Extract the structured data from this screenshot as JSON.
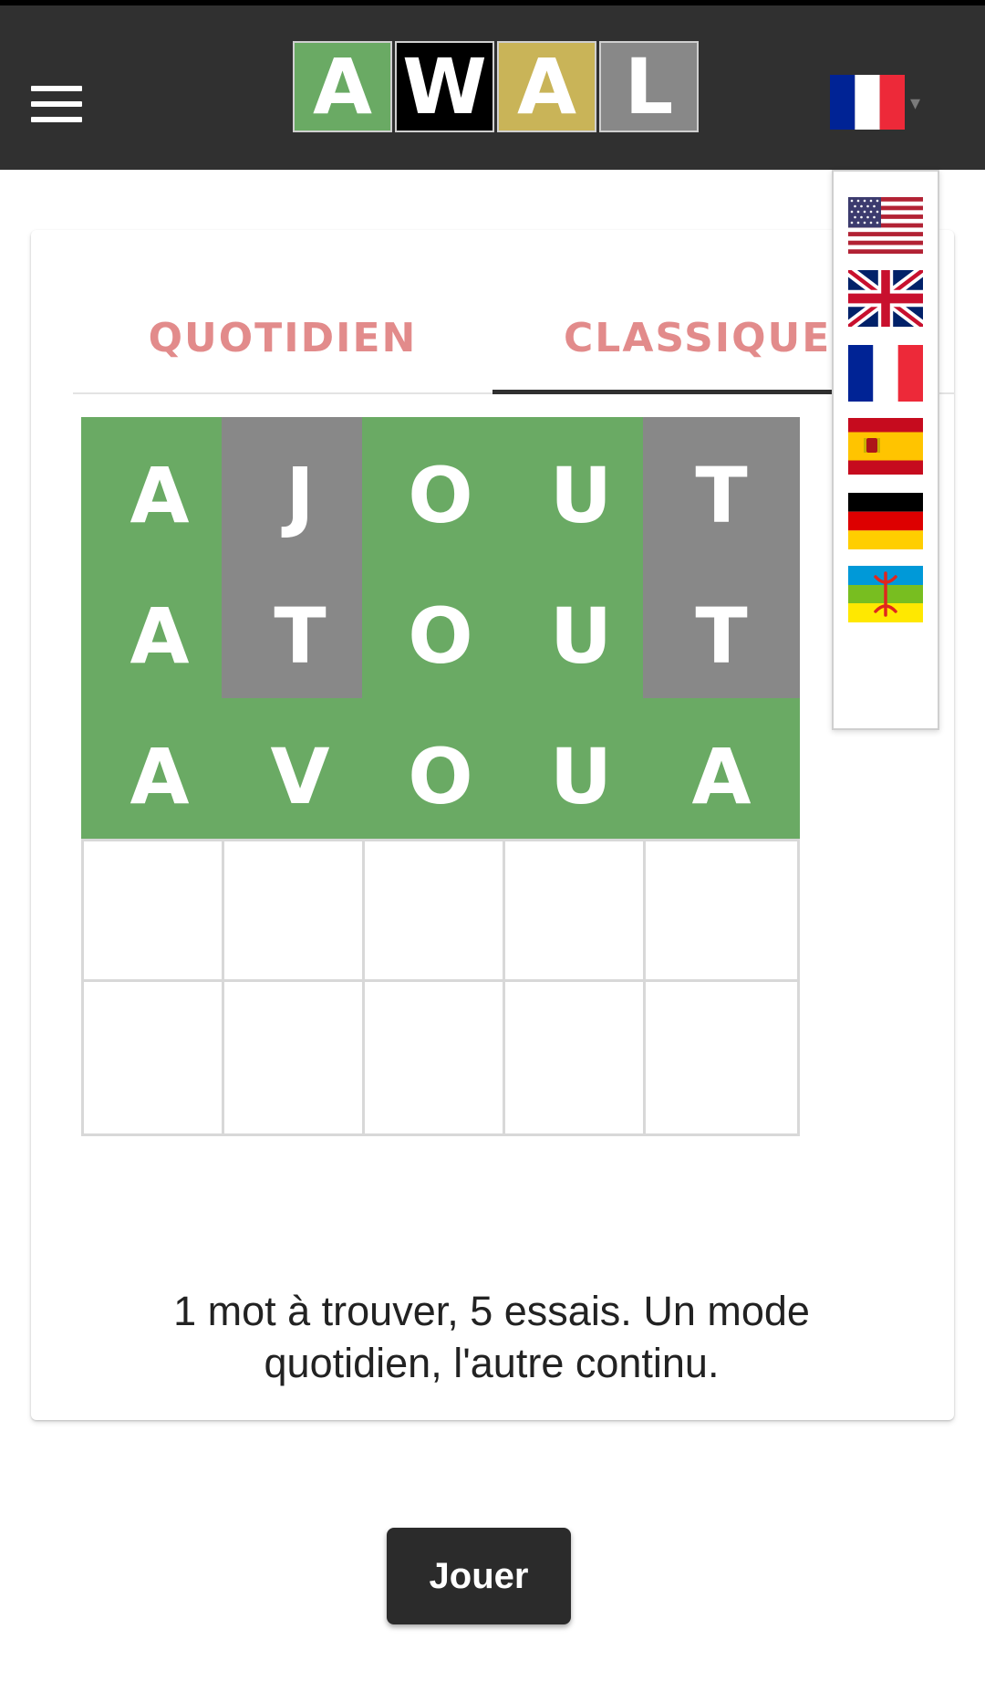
{
  "header": {
    "menu_icon": "hamburger-menu-icon",
    "logo_letters": [
      {
        "char": "A",
        "color": "#6aaa64"
      },
      {
        "char": "W",
        "color": "#000000"
      },
      {
        "char": "A",
        "color": "#c9b458"
      },
      {
        "char": "L",
        "color": "#888888"
      }
    ],
    "current_language": "fr",
    "dropdown_caret": "▾"
  },
  "tabs": {
    "daily_label": "QUOTIDIEN",
    "classic_label": "CLASSIQUE",
    "active": "classic"
  },
  "board": {
    "colors": {
      "green": "#6aaa64",
      "gray": "#888888"
    },
    "rows": [
      [
        {
          "l": "A",
          "s": "green"
        },
        {
          "l": "J",
          "s": "gray"
        },
        {
          "l": "O",
          "s": "green"
        },
        {
          "l": "U",
          "s": "green"
        },
        {
          "l": "T",
          "s": "gray"
        }
      ],
      [
        {
          "l": "A",
          "s": "green"
        },
        {
          "l": "T",
          "s": "gray"
        },
        {
          "l": "O",
          "s": "green"
        },
        {
          "l": "U",
          "s": "green"
        },
        {
          "l": "T",
          "s": "gray"
        }
      ],
      [
        {
          "l": "A",
          "s": "green"
        },
        {
          "l": "V",
          "s": "green"
        },
        {
          "l": "O",
          "s": "green"
        },
        {
          "l": "U",
          "s": "green"
        },
        {
          "l": "A",
          "s": "green"
        }
      ],
      [
        {
          "l": "",
          "s": "empty"
        },
        {
          "l": "",
          "s": "empty"
        },
        {
          "l": "",
          "s": "empty"
        },
        {
          "l": "",
          "s": "empty"
        },
        {
          "l": "",
          "s": "empty"
        }
      ],
      [
        {
          "l": "",
          "s": "empty"
        },
        {
          "l": "",
          "s": "empty"
        },
        {
          "l": "",
          "s": "empty"
        },
        {
          "l": "",
          "s": "empty"
        },
        {
          "l": "",
          "s": "empty"
        }
      ]
    ]
  },
  "description": {
    "line1": "1 mot à trouver, 5 essais. Un mode",
    "line2": "quotidien, l'autre continu."
  },
  "play_button": {
    "label": "Jouer"
  },
  "language_menu": {
    "items": [
      {
        "code": "us",
        "icon": "usa-flag-icon"
      },
      {
        "code": "gb",
        "icon": "uk-flag-icon"
      },
      {
        "code": "fr",
        "icon": "france-flag-icon"
      },
      {
        "code": "es",
        "icon": "spain-flag-icon"
      },
      {
        "code": "de",
        "icon": "germany-flag-icon"
      },
      {
        "code": "ber",
        "icon": "amazigh-flag-icon"
      }
    ]
  }
}
